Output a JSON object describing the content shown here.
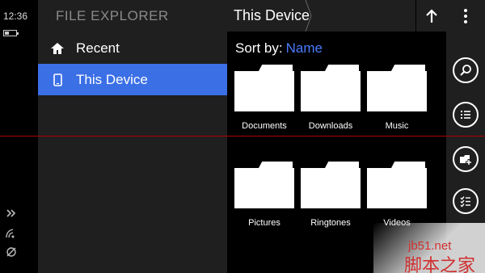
{
  "status_bar": {
    "time": "12:36",
    "battery_level": 0.35,
    "icons": [
      "signal-icon",
      "wifi-icon",
      "location-icon"
    ]
  },
  "left_pane": {
    "title": "FILE EXPLORER",
    "items": [
      {
        "label": "Recent",
        "icon": "home-icon",
        "selected": false
      },
      {
        "label": "This Device",
        "icon": "phone-icon",
        "selected": true
      }
    ]
  },
  "main": {
    "breadcrumb": "This Device",
    "sort_label": "Sort by:",
    "sort_value": "Name",
    "folders": [
      {
        "name": "Documents"
      },
      {
        "name": "Downloads"
      },
      {
        "name": "Music"
      },
      {
        "name": "Pictures"
      },
      {
        "name": "Ringtones"
      },
      {
        "name": "Videos"
      }
    ]
  },
  "app_bar": {
    "buttons": [
      "search-icon",
      "list-icon",
      "new-folder-icon",
      "select-icon"
    ]
  },
  "watermark": {
    "url": "jb51.net",
    "site_name": "脚本之家"
  },
  "colors": {
    "accent": "#3b6fe6",
    "sort_link": "#4a7cff",
    "pane_bg": "#1f1f1f",
    "overlay_line": "#b00000"
  }
}
